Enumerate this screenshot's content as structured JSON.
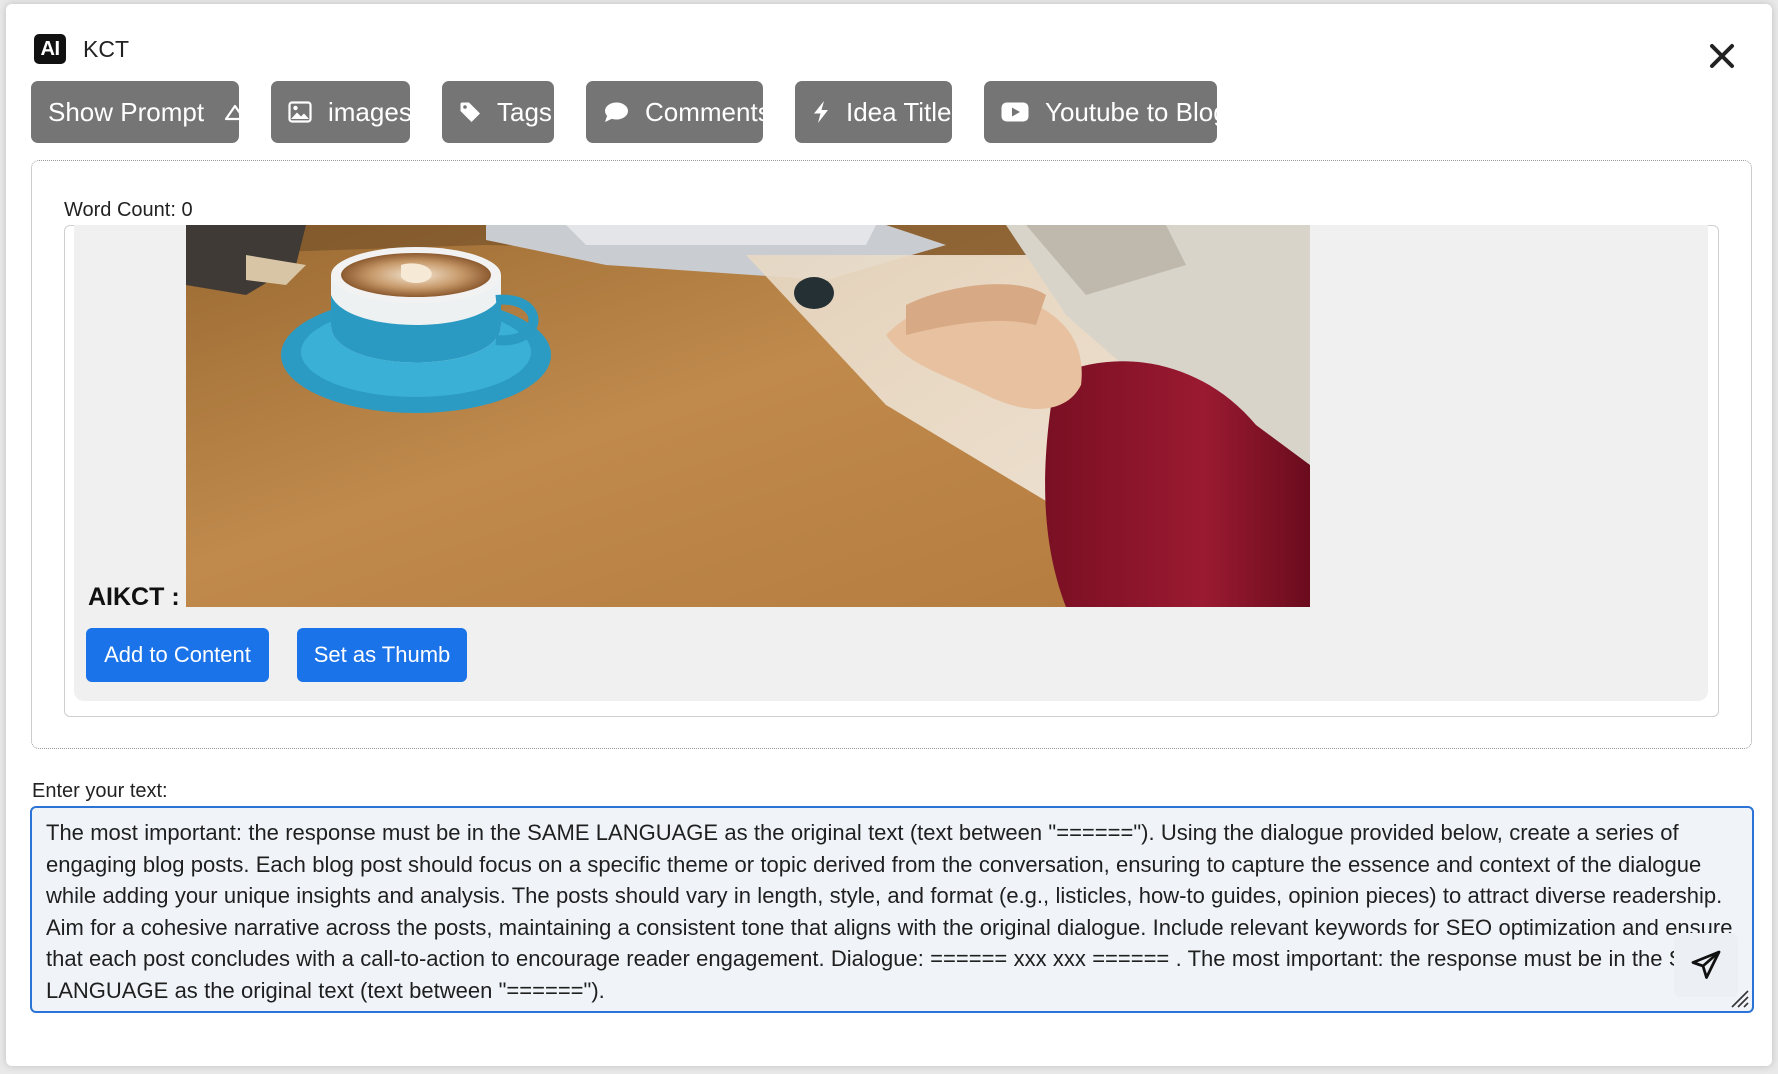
{
  "header": {
    "logo_text": "AI",
    "title": "KCT"
  },
  "toolbar": {
    "show_prompt": "Show Prompt",
    "images": "images",
    "tags": "Tags",
    "comments": "Comments",
    "idea_title": "Idea Title",
    "youtube_to_blog": "Youtube to Blog"
  },
  "output": {
    "word_count": "Word Count: 0",
    "sender": "AIKCT :",
    "image_icon": "photo-of-coffee-cup-and-hand-on-mouse",
    "add_to_content": "Add to Content",
    "set_as_thumb": "Set as Thumb"
  },
  "input": {
    "label": "Enter your text:",
    "value": "The most important: the response must be in the SAME LANGUAGE as the original text (text between \"======\"). Using the dialogue provided below, create a series of engaging blog posts. Each blog post should focus on a specific theme or topic derived from the conversation, ensuring to capture the essence and context of the dialogue while adding your unique insights and analysis. The posts should vary in length, style, and format (e.g., listicles, how-to guides, opinion pieces) to attract diverse readership. Aim for a cohesive narrative across the posts, maintaining a consistent tone that aligns with the original dialogue. Include relevant keywords for SEO optimization and ensure that each post concludes with a call-to-action to encourage reader engagement. Dialogue: ====== xxx xxx ====== . The most important: the response must be in the SAME LANGUAGE as the original text (text between \"======\")."
  },
  "colors": {
    "toolbar_button": "#757575",
    "primary_button": "#1a73e8",
    "textarea_border": "#2b73d6"
  }
}
